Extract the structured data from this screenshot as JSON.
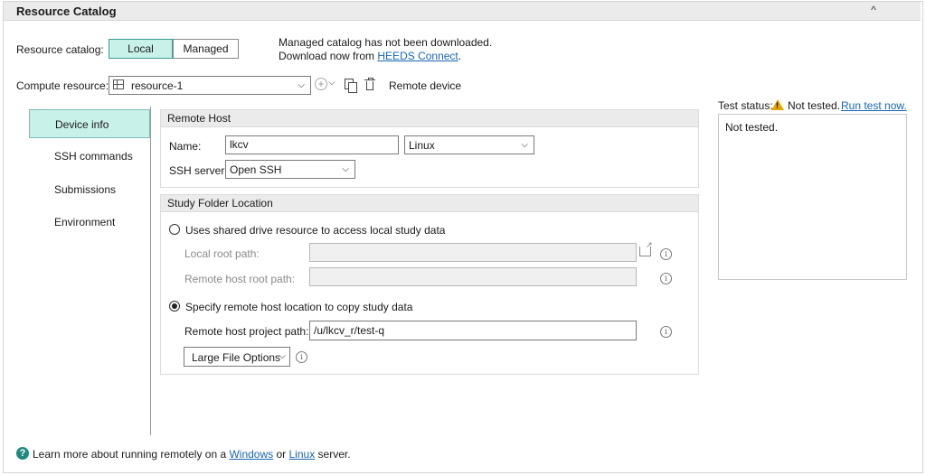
{
  "panel": {
    "title": "Resource Catalog",
    "collapse_glyph": "^"
  },
  "catalog": {
    "label": "Resource catalog:",
    "local_label": "Local",
    "managed_label": "Managed",
    "notice_line1": "Managed catalog has not been downloaded.",
    "notice_line2_prefix": "Download now from ",
    "notice_link": "HEEDS Connect",
    "notice_suffix": "."
  },
  "compute": {
    "label": "Compute resource:",
    "selected": "resource-1",
    "remote_label": "Remote device",
    "icons": [
      "table-icon",
      "add-icon",
      "chevron-down-icon",
      "copy-icon",
      "delete-icon"
    ]
  },
  "nav": {
    "items": [
      {
        "label": "Device info",
        "active": true
      },
      {
        "label": "SSH commands"
      },
      {
        "label": "Submissions"
      },
      {
        "label": "Environment"
      }
    ]
  },
  "remote_host": {
    "header": "Remote Host",
    "name_label": "Name:",
    "name_value": "lkcv",
    "os_value": "Linux",
    "ssh_label": "SSH server:",
    "ssh_value": "Open SSH"
  },
  "study_folder": {
    "header": "Study Folder Location",
    "option1_label": "Uses shared drive resource to access local study data",
    "local_root_label": "Local root path:",
    "remote_root_label": "Remote host root path:",
    "option2_label": "Specify remote host location to copy study data",
    "project_path_label": "Remote host project path:",
    "project_path_value": "/u/lkcv_r/test-q",
    "large_file_label": "Large File Options"
  },
  "test": {
    "status_label": "Test status:",
    "status_value": "Not tested.",
    "run_link": "Run test now.",
    "output": "Not tested."
  },
  "footer": {
    "prefix": "Learn more about running remotely on a ",
    "windows_link": "Windows",
    "or": " or ",
    "linux_link": "Linux",
    "suffix": " server."
  },
  "colors": {
    "accent": "#c8f1ea",
    "accent_border": "#3a9d94",
    "link": "#1866b4",
    "warning": "#e6a700",
    "help": "#1e8a7e"
  }
}
